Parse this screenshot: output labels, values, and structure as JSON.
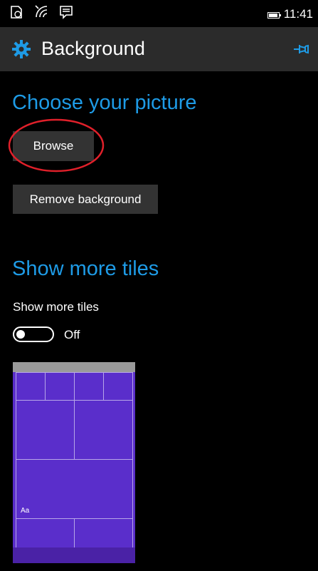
{
  "status_bar": {
    "time": "11:41",
    "icons": [
      "app-notification-icon",
      "wifi-icon",
      "message-icon",
      "battery-icon"
    ]
  },
  "header": {
    "title": "Background",
    "icon": "gear-icon",
    "action_icon": "pin-icon"
  },
  "picture_section": {
    "heading": "Choose your picture",
    "browse_label": "Browse",
    "remove_label": "Remove background"
  },
  "tiles_section": {
    "heading": "Show more tiles",
    "toggle_label": "Show more tiles",
    "toggle_state": "Off",
    "toggle_on": false
  },
  "preview": {
    "tile_text": "Aa"
  },
  "colors": {
    "accent": "#1e9be6",
    "header_bg": "#2b2b2b",
    "button_bg": "#333333",
    "preview_tile": "#5a2ecb",
    "annotation": "#e0202a"
  }
}
